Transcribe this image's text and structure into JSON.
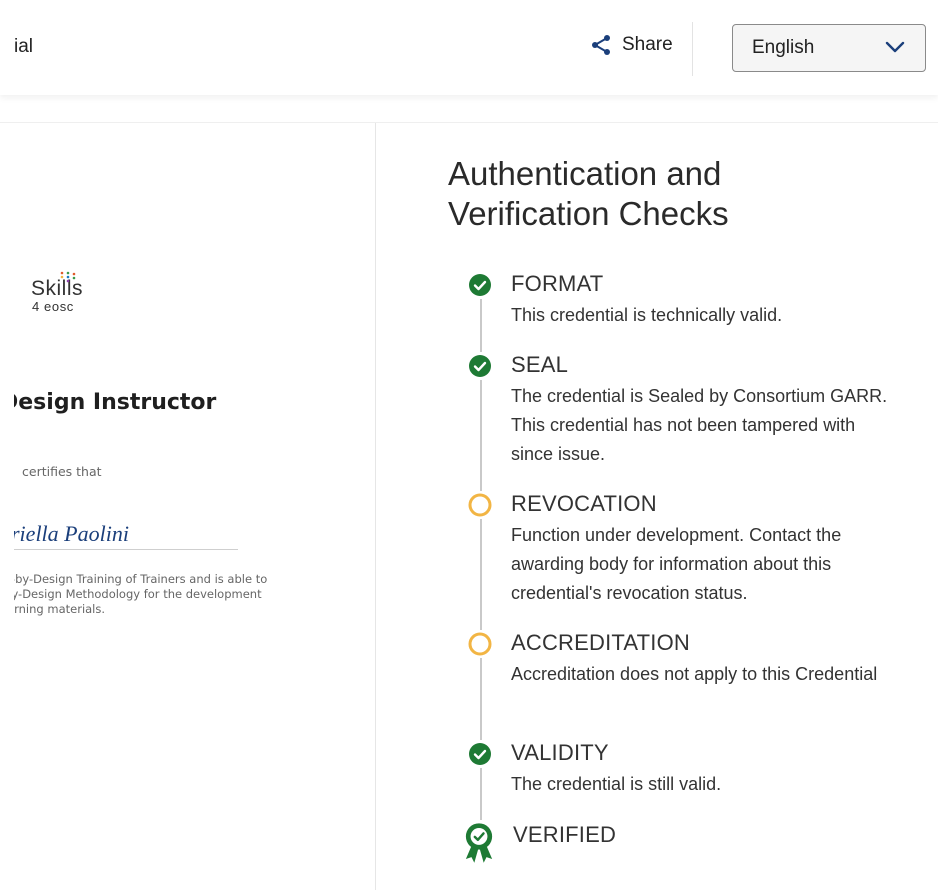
{
  "header": {
    "title": "ial",
    "share_label": "Share",
    "language": {
      "selected": "English"
    }
  },
  "certificate": {
    "logo": {
      "main": "Skills",
      "sub": "4 eosc"
    },
    "title": "Design Instructor",
    "intro": "certifies that",
    "recipient": "briella Paolini",
    "description_lines": [
      "IR-by-Design Training of Trainers and is able to",
      "-by-Design Methodology for the development",
      "earning materials."
    ]
  },
  "checks": {
    "title_line1": "Authentication and",
    "title_line2": "Verification Checks",
    "items": [
      {
        "name": "FORMAT",
        "status": "passed",
        "description": "This credential is technically valid."
      },
      {
        "name": "SEAL",
        "status": "passed",
        "description": "The credential is Sealed by Consortium GARR. This credential has not been tampered with since issue."
      },
      {
        "name": "REVOCATION",
        "status": "pending",
        "description": "Function under development. Contact the awarding body for information about this credential's revocation status."
      },
      {
        "name": "ACCREDITATION",
        "status": "pending",
        "description": "Accreditation does not apply to this Credential"
      },
      {
        "name": "VALIDITY",
        "status": "passed",
        "description": "The credential is still valid."
      },
      {
        "name": "VERIFIED",
        "status": "verified",
        "description": ""
      }
    ]
  },
  "colors": {
    "passed": "#1e7a34",
    "pending": "#f2b544",
    "accent": "#1b3f7b",
    "title_text": "#2a2a2a"
  },
  "icons": {
    "share": "share-icon",
    "dropdown": "chevron-down-icon",
    "passed": "check-circle-icon",
    "pending": "hollow-circle-icon",
    "verified": "award-badge-icon"
  }
}
